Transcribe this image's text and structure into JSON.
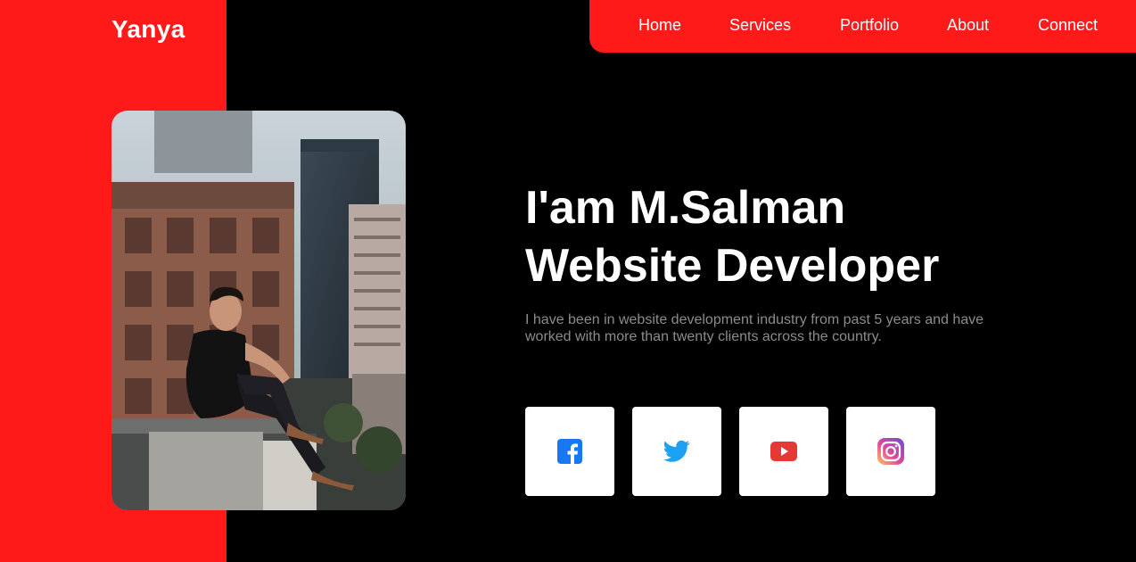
{
  "brand": {
    "name": "Yanya"
  },
  "nav": {
    "items": [
      {
        "label": "Home"
      },
      {
        "label": "Services"
      },
      {
        "label": "Portfolio"
      },
      {
        "label": "About"
      },
      {
        "label": "Connect"
      }
    ]
  },
  "hero": {
    "line1": "I'am M.Salman",
    "line2": "Website Developer",
    "bio": "I have been in website development industry from past 5 years and have worked with more than twenty clients across the country."
  },
  "socials": [
    {
      "name": "facebook",
      "icon": "facebook-icon",
      "color": "#1877f2"
    },
    {
      "name": "twitter",
      "icon": "twitter-icon",
      "color": "#1da1f2"
    },
    {
      "name": "youtube",
      "icon": "youtube-icon",
      "color": "#e53935"
    },
    {
      "name": "instagram",
      "icon": "instagram-icon",
      "color": "#d6249f"
    }
  ],
  "colors": {
    "accent": "#ff1a1a",
    "background": "#000000",
    "text": "#ffffff",
    "muted": "#8c8c8c"
  }
}
